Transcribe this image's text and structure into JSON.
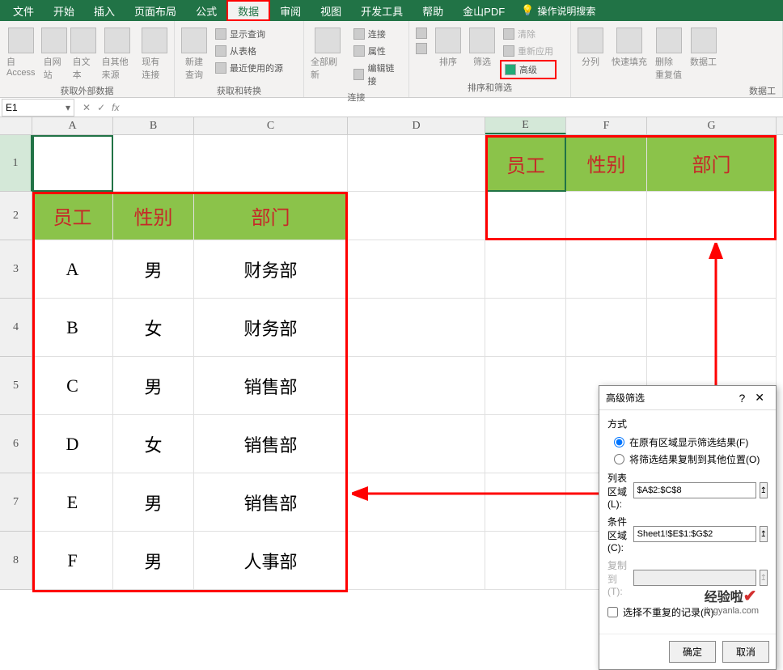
{
  "tabs": {
    "file": "文件",
    "home": "开始",
    "insert": "插入",
    "pagelayout": "页面布局",
    "formulas": "公式",
    "data": "数据",
    "review": "审阅",
    "view": "视图",
    "developer": "开发工具",
    "help": "帮助",
    "wps": "金山PDF",
    "search": "操作说明搜索"
  },
  "ribbon": {
    "group1": {
      "access": "自 Access",
      "web": "自网站",
      "text": "自文本",
      "other": "自其他来源",
      "existing": "现有连接",
      "label": "获取外部数据"
    },
    "group2": {
      "newquery": "新建\n查询",
      "showquery": "显示查询",
      "fromtable": "从表格",
      "recent": "最近使用的源",
      "label": "获取和转换"
    },
    "group3": {
      "refresh": "全部刷新",
      "conn": "连接",
      "prop": "属性",
      "editlink": "编辑链接",
      "label": "连接"
    },
    "group4": {
      "sort_asc": "A↓Z",
      "sort_desc": "Z↓A",
      "sort": "排序",
      "filter": "筛选",
      "clear": "清除",
      "reapply": "重新应用",
      "advanced": "高级",
      "label": "排序和筛选"
    },
    "group5": {
      "texttocol": "分列",
      "flashfill": "快速填充",
      "removedupe": "删除\n重复值",
      "datavalid": "数据工",
      "label": "数据工"
    }
  },
  "namebox": "E1",
  "cols": {
    "A": "A",
    "B": "B",
    "C": "C",
    "D": "D",
    "E": "E",
    "F": "F",
    "G": "G"
  },
  "rows_h": {
    "1": "1",
    "2": "2",
    "3": "3",
    "4": "4",
    "5": "5",
    "6": "6",
    "7": "7",
    "8": "8"
  },
  "headers": {
    "emp": "员工",
    "gender": "性别",
    "dept": "部门"
  },
  "table": [
    {
      "emp": "A",
      "gender": "男",
      "dept": "财务部"
    },
    {
      "emp": "B",
      "gender": "女",
      "dept": "财务部"
    },
    {
      "emp": "C",
      "gender": "男",
      "dept": "销售部"
    },
    {
      "emp": "D",
      "gender": "女",
      "dept": "销售部"
    },
    {
      "emp": "E",
      "gender": "男",
      "dept": "销售部"
    },
    {
      "emp": "F",
      "gender": "男",
      "dept": "人事部"
    }
  ],
  "dialog": {
    "title": "高级筛选",
    "mode_label": "方式",
    "radio1": "在原有区域显示筛选结果(F)",
    "radio2": "将筛选结果复制到其他位置(O)",
    "field1_label": "列表区域(L):",
    "field1_value": "$A$2:$C$8",
    "field2_label": "条件区域(C):",
    "field2_value": "Sheet1!$E$1:$G$2",
    "field3_label": "复制到(T):",
    "field3_value": "",
    "check": "选择不重复的记录(R)",
    "ok": "确定",
    "cancel": "取消"
  },
  "watermark": {
    "main": "经验啦",
    "sub": "jingyanla.com"
  }
}
